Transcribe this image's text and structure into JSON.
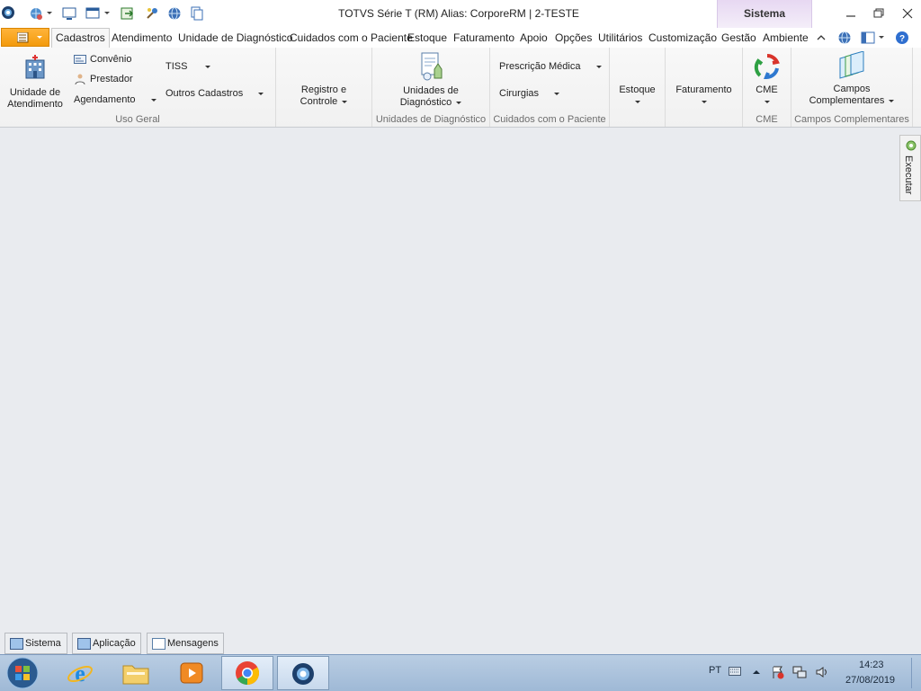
{
  "window": {
    "title": "TOTVS Série T  (RM) Alias: CorporeRM | 2-TESTE",
    "context_tab": "Sistema"
  },
  "ribbon_tabs": [
    "Cadastros",
    "Atendimento",
    "Unidade de Diagnóstico",
    "Cuidados com o Paciente",
    "Estoque",
    "Faturamento",
    "Apoio",
    "Opções",
    "Utilitários",
    "Customização",
    "Gestão",
    "Ambiente"
  ],
  "active_tab": "Cadastros",
  "groups": {
    "uso_geral": {
      "label": "Uso Geral",
      "unidade_atendimento": "Unidade de\nAtendimento",
      "convenio": "Convênio",
      "prestador": "Prestador",
      "agendamento": "Agendamento",
      "tiss": "TISS",
      "outros_cadastros": "Outros Cadastros"
    },
    "registro": {
      "label": "Registro e\nControle"
    },
    "unid_diag": {
      "label": "Unidades de Diagnóstico",
      "button": "Unidades de\nDiagnóstico"
    },
    "cuidados": {
      "label": "Cuidados com o Paciente",
      "prescricao": "Prescrição Médica",
      "cirurgias": "Cirurgias"
    },
    "estoque": {
      "button": "Estoque"
    },
    "faturamento": {
      "button": "Faturamento"
    },
    "cme": {
      "label": "CME",
      "button": "CME"
    },
    "campos": {
      "label": "Campos Complementares",
      "button": "Campos\nComplementares"
    }
  },
  "side_tab": "Executar",
  "bottom_tabs": [
    "Sistema",
    "Aplicação",
    "Mensagens"
  ],
  "tray": {
    "lang": "PT",
    "time": "14:23",
    "date": "27/08/2019"
  },
  "colors": {
    "accent_orange": "#f5a623",
    "context_purple": "#e7d8f2",
    "workspace": "#e9ebef"
  }
}
